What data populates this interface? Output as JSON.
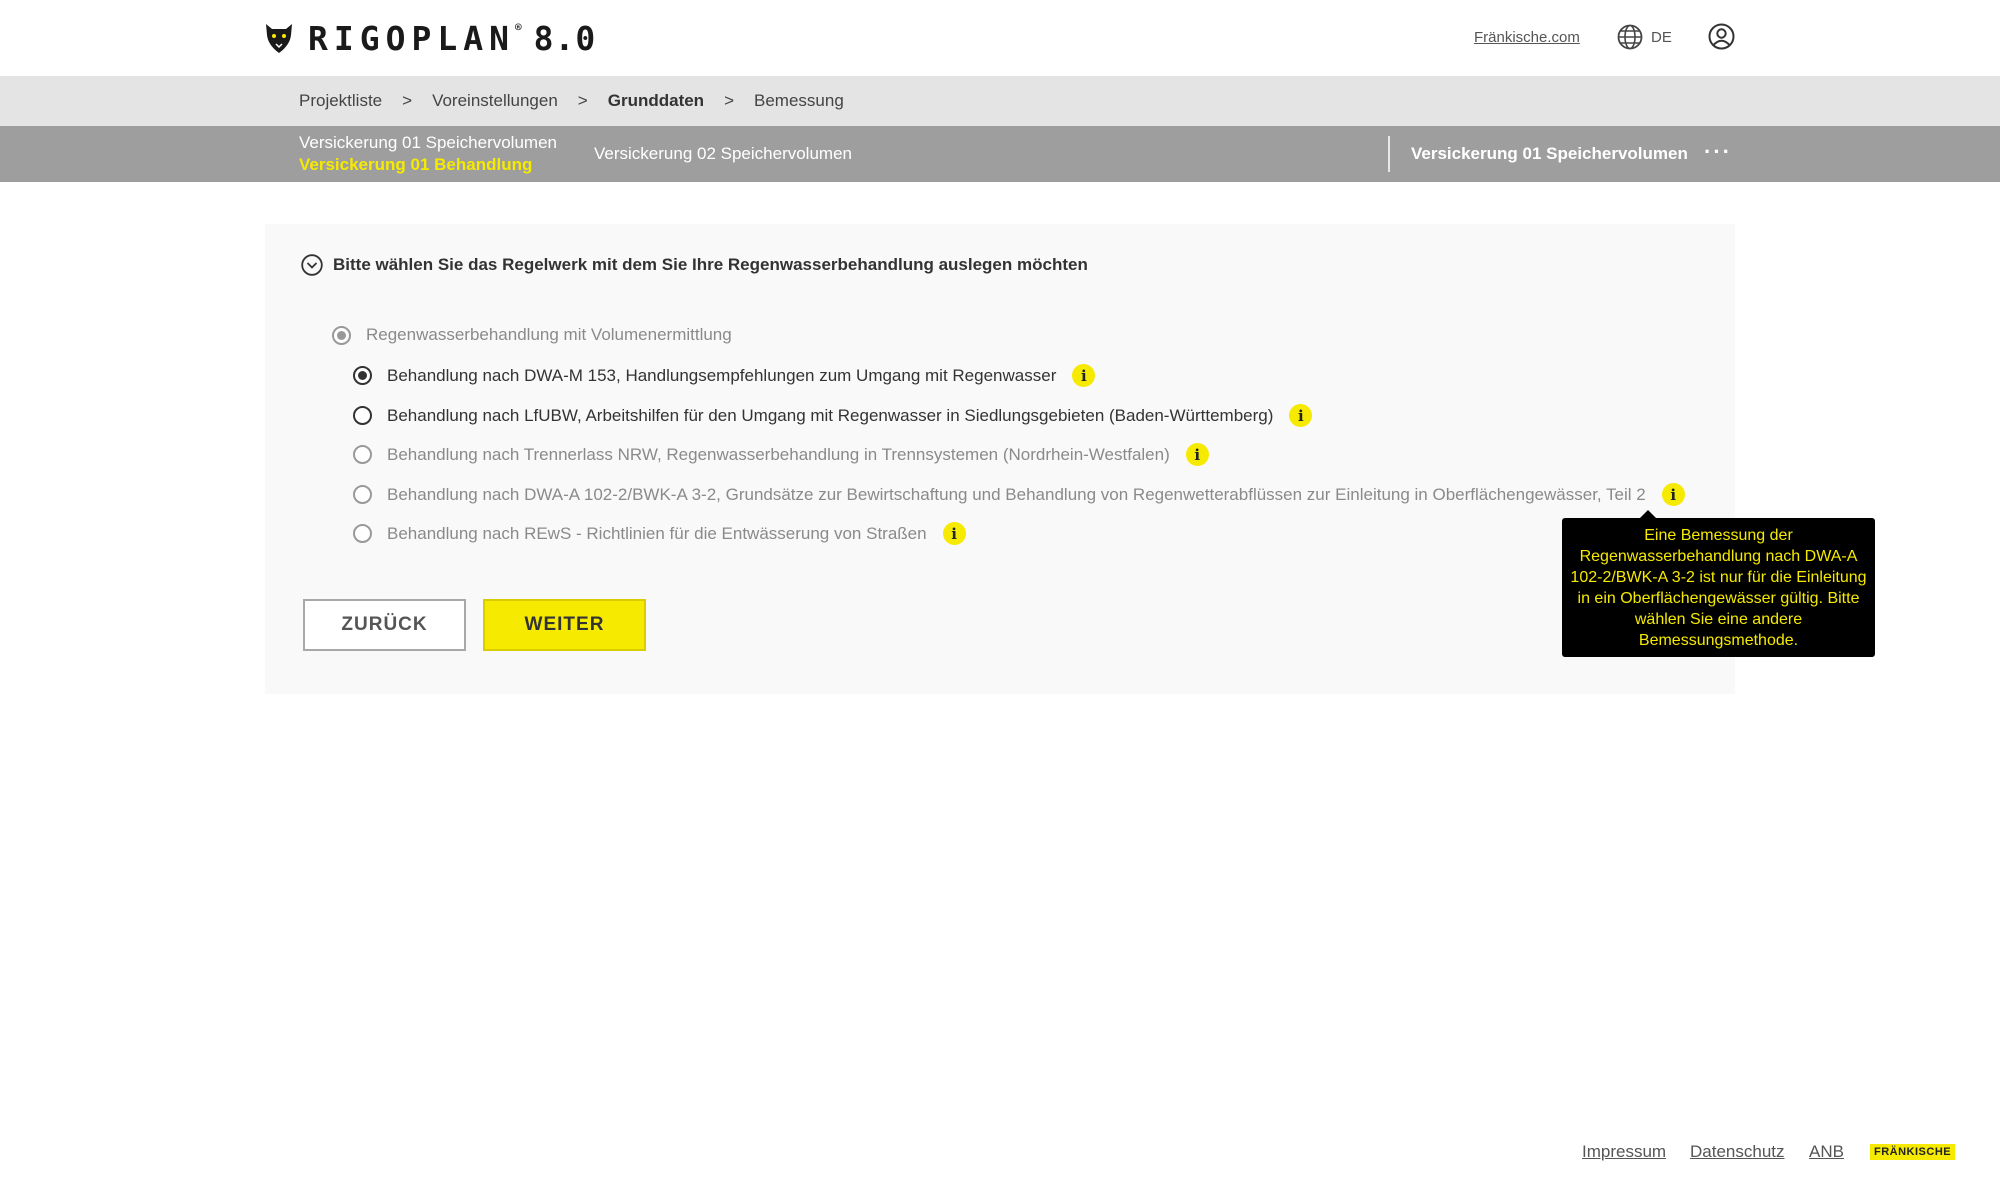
{
  "header": {
    "brand": "RIGOPLAN",
    "brand_reg": "®",
    "version": "8.0",
    "link": "Fränkische.com",
    "language": "DE"
  },
  "breadcrumb": [
    "Projektliste",
    "Voreinstellungen",
    "Grunddaten",
    "Bemessung"
  ],
  "breadcrumb_sep": ">",
  "tabs": {
    "tab1_line1": "Versickerung 01 Speichervolumen",
    "tab1_line2": "Versickerung 01 Behandlung",
    "tab2": "Versickerung 02 Speichervolumen",
    "current": "Versickerung 01 Speichervolumen",
    "more": "···"
  },
  "form": {
    "title": "Bitte wählen Sie das Regelwerk mit dem Sie Ihre Regenwasserbehandlung auslegen möchten",
    "group_label": "Regenwasserbehandlung mit Volumenermittlung",
    "options": [
      "Behandlung nach DWA-M 153, Handlungsempfehlungen zum Umgang mit Regenwasser",
      "Behandlung nach LfUBW, Arbeitshilfen für den Umgang mit Regenwasser in Siedlungsgebieten (Baden-Württemberg)",
      "Behandlung nach Trennerlass NRW, Regenwasserbehandlung in Trennsystemen (Nordrhein-Westfalen)",
      "Behandlung nach DWA-A 102-2/BWK-A 3-2, Grundsätze zur Bewirtschaftung und Behandlung von Regenwetterabflüssen zur Einleitung in Oberflächengewässer, Teil 2",
      "Behandlung nach REwS - Richtlinien für die Entwässerung von Straßen"
    ],
    "info_glyph": "i",
    "back_label": "ZURÜCK",
    "next_label": "WEITER"
  },
  "tooltip": "Eine Bemessung der Regenwasserbehandlung nach DWA-A 102-2/BWK-A 3-2 ist nur für die Einleitung in ein Oberflächengewässer gültig. Bitte wählen Sie eine andere Bemessungsmethode.",
  "footer": {
    "impressum": "Impressum",
    "datenschutz": "Datenschutz",
    "anb": "ANB",
    "brand": "FRÄNKISCHE"
  },
  "colors": {
    "accent": "#f5ea00",
    "tabbar": "#9e9e9e",
    "breadcrumb_bg": "#e4e4e4",
    "card_bg": "#f9f9f9"
  }
}
